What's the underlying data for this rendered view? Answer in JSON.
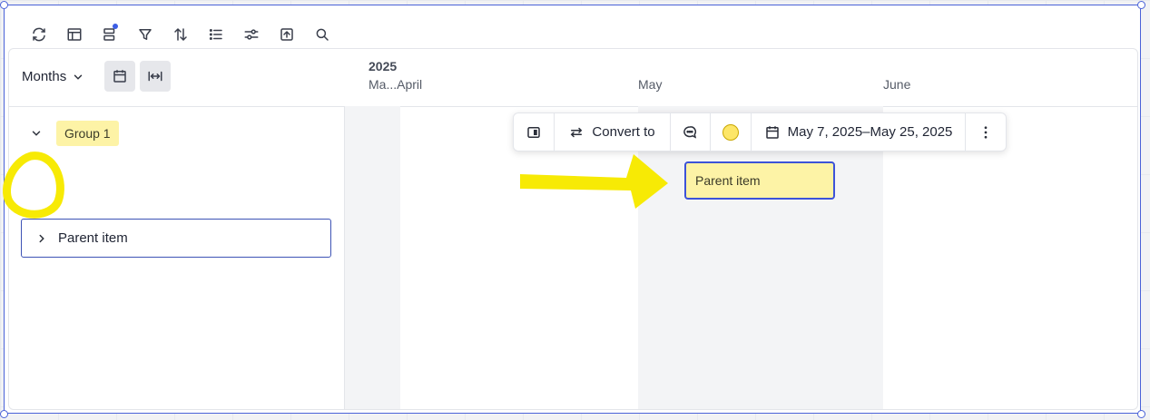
{
  "toolbar": {
    "icons": [
      "sync-icon",
      "layout-icon",
      "card-fields-icon",
      "filter-icon",
      "sort-icon",
      "list-icon",
      "settings-sliders-icon",
      "export-icon",
      "search-icon"
    ]
  },
  "header": {
    "zoom_label": "Months",
    "year": "2025",
    "months": [
      "Ma...April",
      "May",
      "June"
    ]
  },
  "tree": {
    "group_label": "Group 1",
    "item_label": "Parent item"
  },
  "timeline": {
    "bar_label": "Parent item"
  },
  "context_menu": {
    "convert_label": "Convert to",
    "date_range": "May 7, 2025–May 25, 2025"
  },
  "colors": {
    "accent": "#3d53d8",
    "highlight": "#fdf3a6",
    "annotation": "#f7ea05"
  }
}
